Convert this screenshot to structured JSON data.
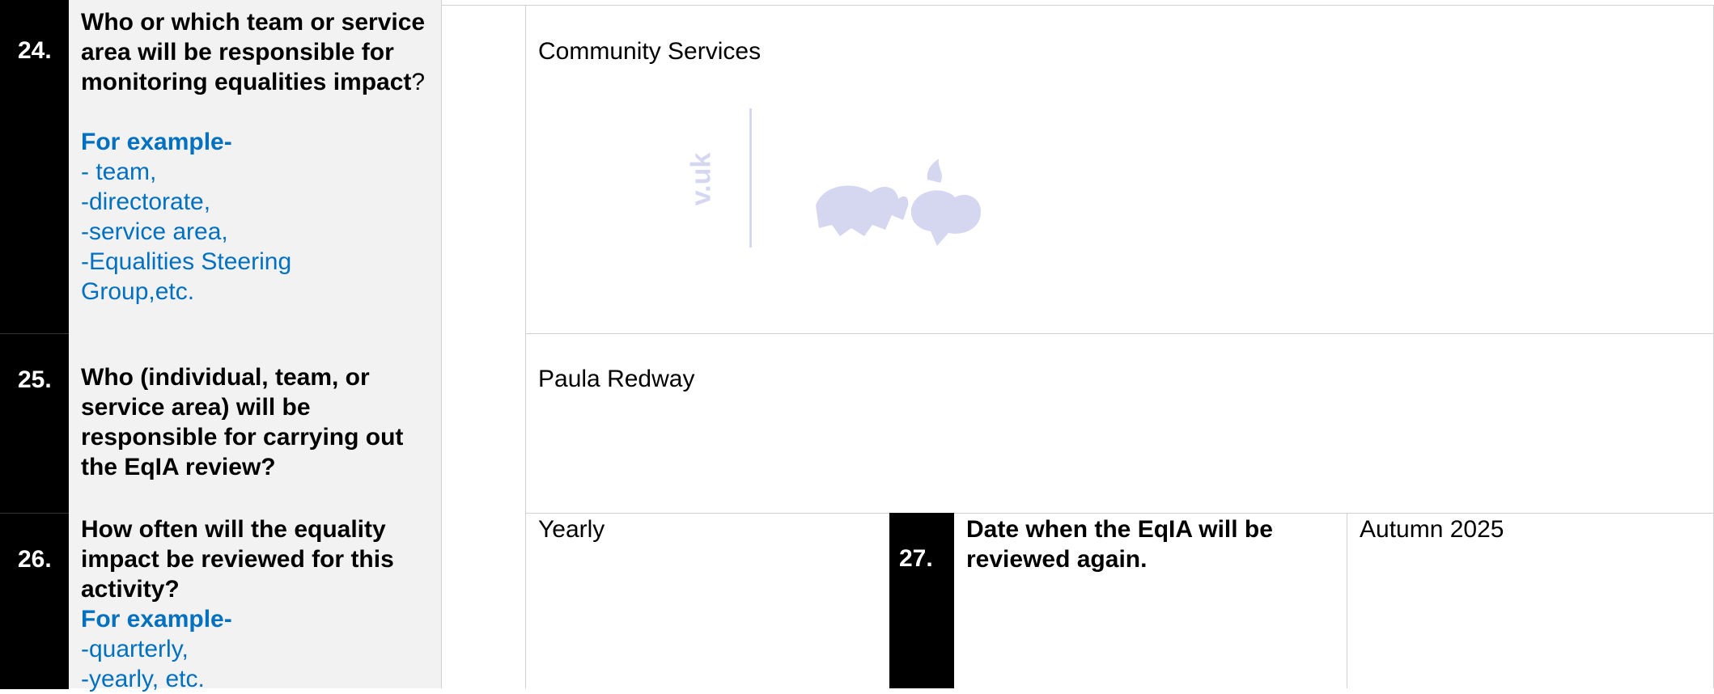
{
  "rows": [
    {
      "number": "24.",
      "question_bold": "Who or which team or service area will be responsible for monitoring equalities impact",
      "question_suffix": "?",
      "example_heading": "For example-",
      "example_lines": [
        "- team,",
        "-directorate,",
        "-service area,",
        "-Equalities Steering Group,etc."
      ],
      "answer": "Community Services"
    },
    {
      "number": "25.",
      "question_bold": "Who (individual, team, or service area) will be responsible for carrying out the EqIA review?",
      "answer": "Paula Redway"
    },
    {
      "number": "26.",
      "question_bold": "How often will the equality impact be reviewed for this activity?",
      "example_heading": "For example-",
      "example_lines": [
        "-quarterly,",
        "-yearly, etc."
      ],
      "answer": "Yearly"
    },
    {
      "number": "27.",
      "question_bold": "Date when the EqIA will be reviewed again.",
      "answer": "Autumn 2025"
    }
  ],
  "watermark": {
    "text": "v.uk",
    "icon": "crest-logo-icon",
    "color": "#5b5fc7"
  },
  "colors": {
    "number_bg": "#000000",
    "question_bg": "#f2f2f2",
    "example_text": "#0070c0",
    "border": "#d0d0d0"
  }
}
